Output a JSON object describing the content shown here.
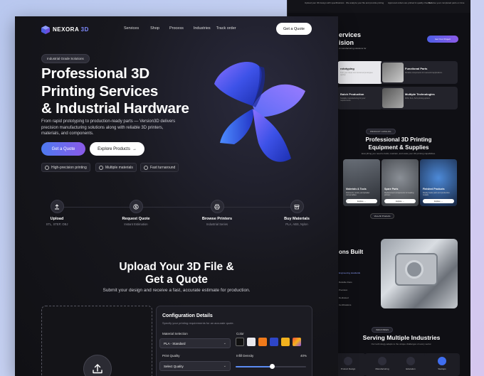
{
  "front": {
    "brand": {
      "name_main": "NEXORA",
      "name_accent": "3D"
    },
    "nav": {
      "links": [
        "Services",
        "Shop",
        "Process",
        "Industries",
        "Track order"
      ],
      "cta": "Get a Quote"
    },
    "hero": {
      "badge": "Industrial Grade Solutions",
      "title_line1": "Professional 3D",
      "title_line2": "Printing Services",
      "title_line3": "& Industrial Hardware",
      "subtitle": "From rapid prototyping to production-ready parts — Version3D delivers precision manufacturing solutions along with reliable 3D printers, materials, and components.",
      "primary_cta": "Get a Quote",
      "secondary_cta": "Explore Products",
      "features": [
        "High-precision printing",
        "Multiple materials",
        "Fast turnaround"
      ]
    },
    "steps": [
      {
        "title": "Upload",
        "sub": "STL, STEP, OBJ"
      },
      {
        "title": "Request Quote",
        "sub": "Instant Estimation"
      },
      {
        "title": "Browse Printers",
        "sub": "Industrial Series"
      },
      {
        "title": "Buy Materials",
        "sub": "PLA, ABS, Nylon"
      }
    ],
    "upload": {
      "title_line1": "Upload Your 3D File &",
      "title_line2": "Get a Quote",
      "subtitle": "Submit your design and receive a fast, accurate estimate for production."
    },
    "config": {
      "title": "Configuration Details",
      "subtitle": "Specify your printing requirements for an accurate quote.",
      "material_label": "Material Selection",
      "material_value": "PLA - Standard",
      "color_label": "Color",
      "colors": [
        "#111111",
        "#e9e9ee",
        "#f07a1a",
        "#2e46c8",
        "#f2b21e",
        "gradient"
      ],
      "quality_label": "Print Quality",
      "quality_value": "Select Quality",
      "infill_label": "Infill Density",
      "infill_value": "40%",
      "infill_fraction": 0.4
    }
  },
  "back": {
    "top_notes": [
      "Upload your 3D design with specifications",
      "We analyze your file and provide pricing",
      "Approved orders are printed & quality checked",
      "Receive your completed parts on time"
    ],
    "services_title_line1": "ervices",
    "services_title_line2": "ision",
    "services_sub": "d manufacturing solutions for",
    "services_cta": "Get Your Project",
    "service_cards": [
      {
        "title": "rototyping",
        "desc": "Turn your ideas into functional prototypes quickly",
        "light": true
      },
      {
        "title": "Functional Parts",
        "desc": "Durable components for real-world applications",
        "light": false
      },
      {
        "title": "Batch Production",
        "desc": "Scalable manufacturing for your requirements",
        "light": false
      },
      {
        "title": "Multiple Technologies",
        "desc": "FDM, SLA, SLS printing options",
        "light": false
      }
    ],
    "products_badge": "PRODUCT CATALOG",
    "products_title_line1": "Professional 3D Printing",
    "products_title_line2": "Equipment & Supplies",
    "products_sub": "Everything you need to build, maintain, and scale your 3D printing capabilities.",
    "products": [
      {
        "title": "Materials & Tools",
        "desc": "Filaments, resins, and powder consumables",
        "button": "Explore →"
      },
      {
        "title": "Spare Parts",
        "desc": "Replacement components for leading printers",
        "button": "Explore →"
      },
      {
        "title": "Finished Products",
        "desc": "Ready-made parts and production models",
        "button": "Explore →"
      }
    ],
    "view_all": "View All Products",
    "built_title": "ons Built",
    "built_list": [
      "Engineering standards",
      "Reliable Runs",
      "Precision",
      "Dedicated",
      "Certifications"
    ],
    "industries_badge": "INDUSTRIES",
    "industries_title": "Serving Multiple Industries",
    "industries_sub": "Our technology adapts to the unique challenges of every sector.",
    "industries": [
      "Product Design",
      "Manufacturing",
      "Education",
      "Startups"
    ]
  },
  "colors": {
    "accent_start": "#4e7af0",
    "accent_end": "#8a5ae8",
    "bg": "#101014"
  }
}
